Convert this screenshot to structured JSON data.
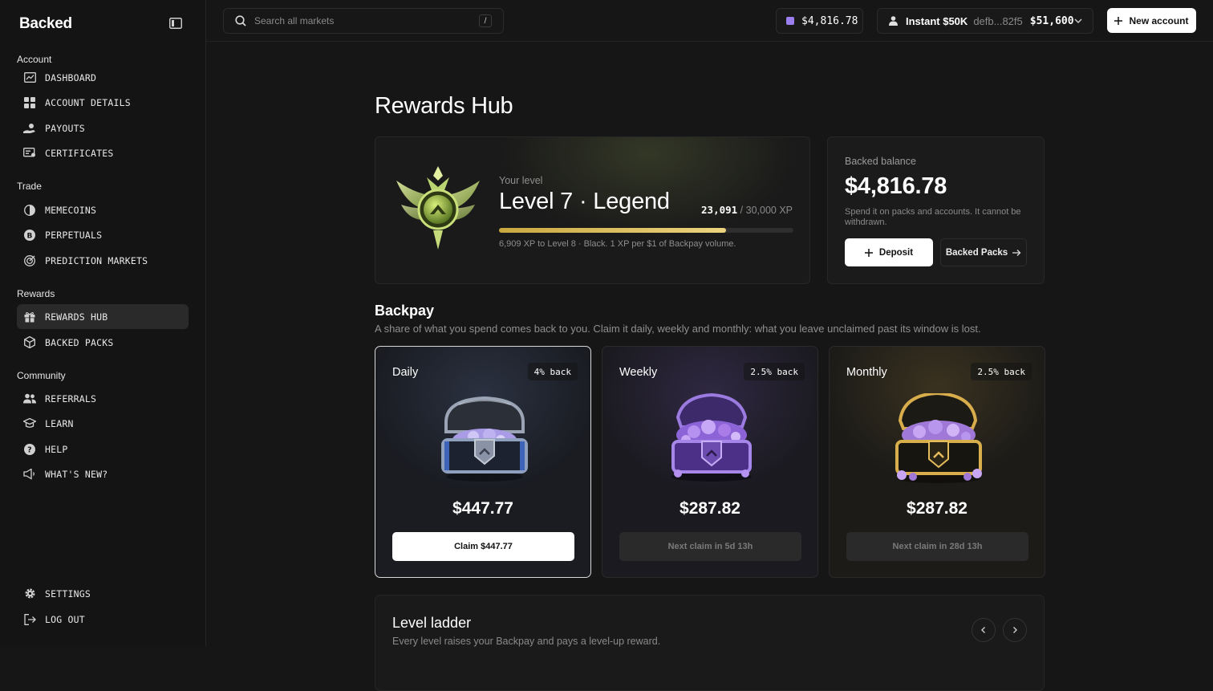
{
  "app": {
    "brand": "Backed"
  },
  "sidebar": {
    "groups": [
      {
        "label": "Account",
        "items": [
          {
            "label": "DASHBOARD",
            "icon": "dashboard-icon"
          },
          {
            "label": "ACCOUNT DETAILS",
            "icon": "grid-icon"
          },
          {
            "label": "PAYOUTS",
            "icon": "payouts-icon"
          },
          {
            "label": "CERTIFICATES",
            "icon": "certificate-icon"
          }
        ]
      },
      {
        "label": "Trade",
        "items": [
          {
            "label": "MEMECOINS",
            "icon": "memecoin-icon"
          },
          {
            "label": "PERPETUALS",
            "icon": "bitcoin-icon"
          },
          {
            "label": "PREDICTION MARKETS",
            "icon": "prediction-icon"
          }
        ]
      },
      {
        "label": "Rewards",
        "items": [
          {
            "label": "REWARDS HUB",
            "icon": "gift-icon",
            "active": true
          },
          {
            "label": "BACKED PACKS",
            "icon": "package-icon"
          }
        ]
      },
      {
        "label": "Community",
        "items": [
          {
            "label": "REFERRALS",
            "icon": "users-icon"
          },
          {
            "label": "LEARN",
            "icon": "graduation-cap-icon"
          },
          {
            "label": "HELP",
            "icon": "help-icon"
          },
          {
            "label": "WHAT'S NEW?",
            "icon": "megaphone-icon"
          }
        ]
      }
    ],
    "bottom": [
      {
        "label": "SETTINGS",
        "icon": "gear-icon"
      },
      {
        "label": "LOG OUT",
        "icon": "logout-icon"
      }
    ]
  },
  "topbar": {
    "search_placeholder": "Search all markets",
    "search_shortcut": "/",
    "wallet_balance": "$4,816.78",
    "account": {
      "name": "Instant $50K",
      "hash": "defb...82f5",
      "balance": "$51,600"
    },
    "new_account_label": "New account"
  },
  "main": {
    "title": "Rewards Hub",
    "level": {
      "your_level_label": "Your level",
      "name": "Level 7 · Legend",
      "xp_current": "23,091",
      "xp_total": "/ 30,000 XP",
      "progress": 0.77,
      "note": "6,909 XP to Level 8 · Black. 1 XP per $1 of Backpay volume."
    },
    "balance": {
      "label": "Backed balance",
      "amount": "$4,816.78",
      "description": "Spend it on packs and accounts. It cannot be withdrawn.",
      "deposit_label": "Deposit",
      "packs_label": "Backed Packs"
    },
    "backpay": {
      "title": "Backpay",
      "subtitle": "A share of what you spend comes back to you. Claim it daily, weekly and monthly: what you leave unclaimed past its window is lost.",
      "cards": [
        {
          "name": "Daily",
          "rate": "4% back",
          "amount": "$447.77",
          "action": "Claim $447.77",
          "enabled": true
        },
        {
          "name": "Weekly",
          "rate": "2.5% back",
          "amount": "$287.82",
          "action": "Next claim in 5d 13h",
          "enabled": false
        },
        {
          "name": "Monthly",
          "rate": "2.5% back",
          "amount": "$287.82",
          "action": "Next claim in 28d 13h",
          "enabled": false
        }
      ]
    },
    "ladder": {
      "title": "Level ladder",
      "subtitle": "Every level raises your Backpay and pays a level-up reward."
    }
  },
  "colors": {
    "accent": "#ecd37e",
    "background": "#161616",
    "wallet": "#9b7ef0"
  }
}
